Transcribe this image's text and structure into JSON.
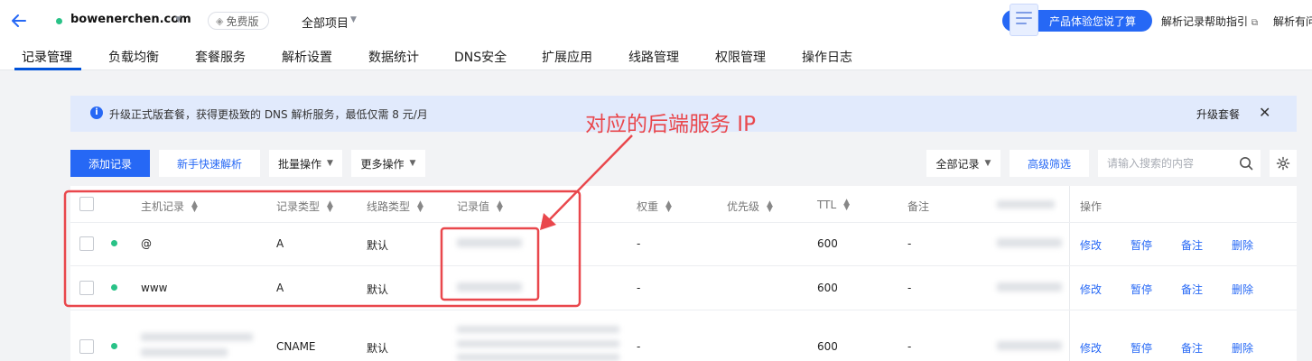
{
  "header": {
    "domain": "bowenerchen.com",
    "free_badge": "免费版",
    "project_select": "全部项目",
    "feedback_button": "产品体验您说了算",
    "help_link": "解析记录帮助指引",
    "help_link_2": "解析有问"
  },
  "tabs": [
    "记录管理",
    "负载均衡",
    "套餐服务",
    "解析设置",
    "数据统计",
    "DNS安全",
    "扩展应用",
    "线路管理",
    "权限管理",
    "操作日志"
  ],
  "notice": {
    "text": "升级正式版套餐，获得更极致的 DNS 解析服务，最低仅需 8 元/月",
    "upgrade": "升级套餐"
  },
  "annotation": "对应的后端服务 IP",
  "toolbar": {
    "add_record": "添加记录",
    "quick_resolve": "新手快速解析",
    "batch": "批量操作",
    "more": "更多操作",
    "filter_all": "全部记录",
    "advanced_filter": "高级筛选",
    "search_placeholder": "请输入搜索的内容"
  },
  "table": {
    "headers": {
      "host": "主机记录",
      "type": "记录类型",
      "line": "线路类型",
      "value": "记录值",
      "weight": "权重",
      "priority": "优先级",
      "ttl": "TTL",
      "remark": "备注",
      "actions": "操作"
    },
    "rows": [
      {
        "host": "@",
        "type": "A",
        "line": "默认",
        "weight": "-",
        "ttl": "600",
        "remark": "-"
      },
      {
        "host": "www",
        "type": "A",
        "line": "默认",
        "weight": "-",
        "ttl": "600",
        "remark": "-"
      },
      {
        "host": "",
        "type": "CNAME",
        "line": "默认",
        "weight": "-",
        "ttl": "600",
        "remark": "-"
      }
    ],
    "actions": {
      "edit": "修改",
      "pause": "暂停",
      "note": "备注",
      "delete": "删除"
    }
  },
  "colors": {
    "primary": "#2668f5",
    "annotation": "#e9474c",
    "status": "#29c287"
  }
}
